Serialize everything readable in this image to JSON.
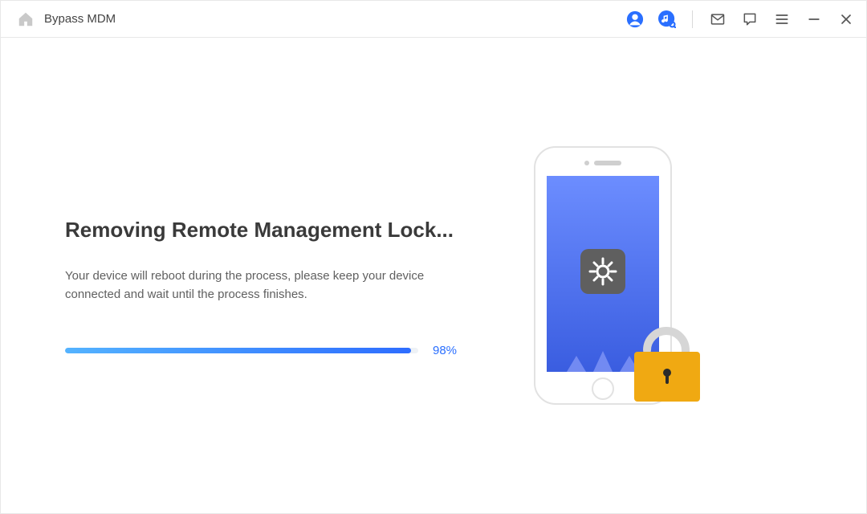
{
  "titlebar": {
    "title": "Bypass MDM",
    "icons": {
      "home": "home-icon",
      "account": "account-icon",
      "music": "music-search-icon",
      "mail": "mail-icon",
      "chat": "chat-icon",
      "menu": "menu-icon",
      "minimize": "minimize-icon",
      "close": "close-icon"
    }
  },
  "main": {
    "heading": "Removing Remote Management Lock...",
    "description": "Your device will reboot during the process, please keep your device connected and wait until the process finishes.",
    "progress": {
      "percent_value": 98,
      "percent_label": "98%",
      "fill_width": "98%"
    }
  },
  "illustration": {
    "device": "phone",
    "overlay_icon": "gear-icon",
    "lock_icon": "lock-icon"
  }
}
